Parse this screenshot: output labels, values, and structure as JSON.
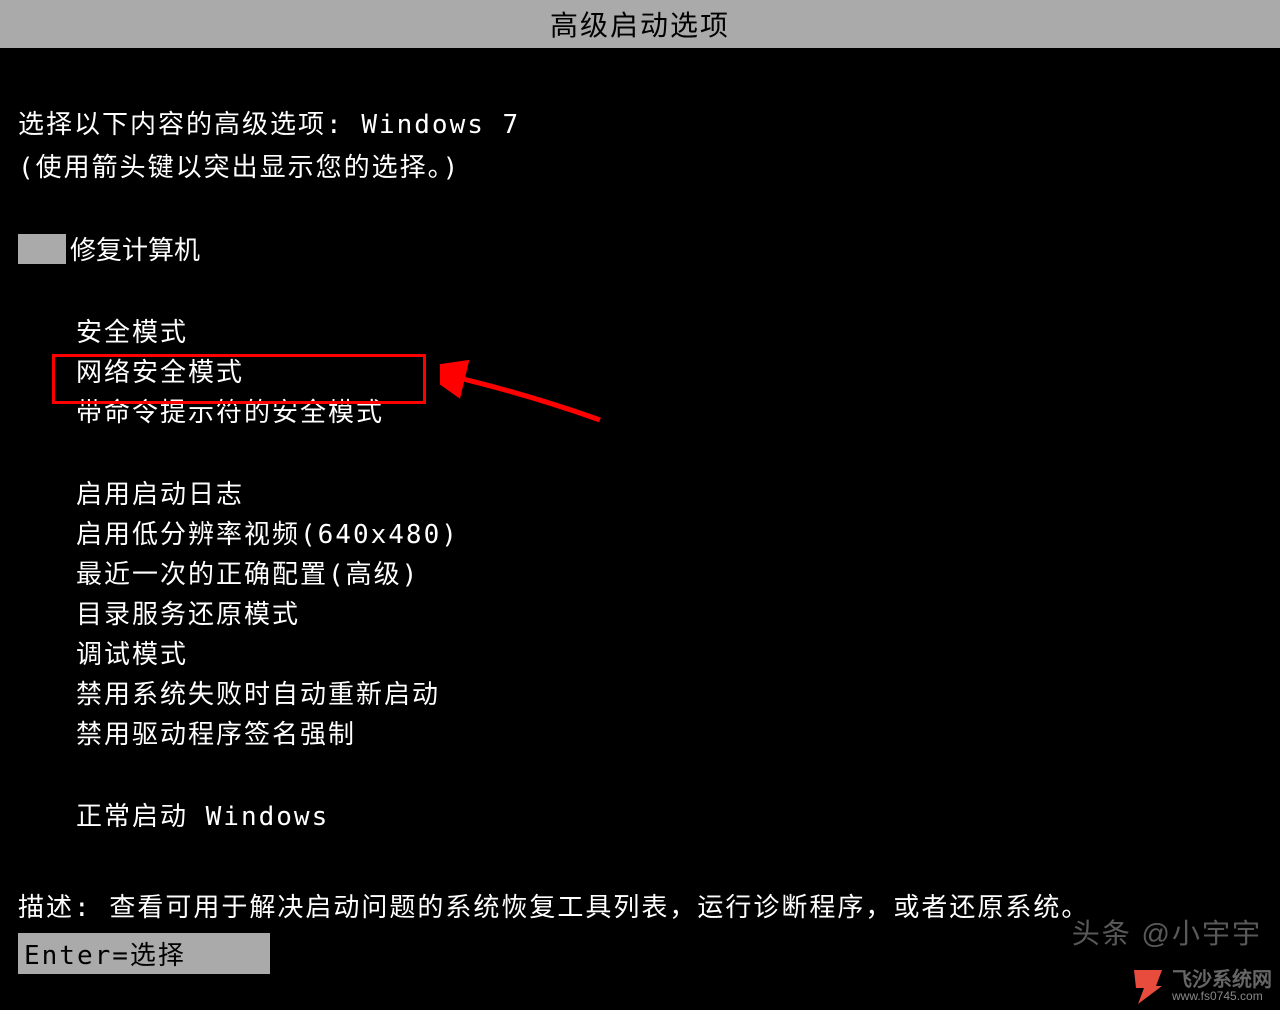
{
  "title": "高级启动选项",
  "prompt_prefix": "选择以下内容的高级选项: ",
  "os_name": "Windows 7",
  "instruction": "(使用箭头键以突出显示您的选择。)",
  "selected_option": "修复计算机",
  "group1": {
    "items": [
      "安全模式",
      "网络安全模式",
      "带命令提示符的安全模式"
    ]
  },
  "group2": {
    "items": [
      "启用启动日志",
      "启用低分辨率视频(640x480)",
      "最近一次的正确配置(高级)",
      "目录服务还原模式",
      "调试模式",
      "禁用系统失败时自动重新启动",
      "禁用驱动程序签名强制"
    ]
  },
  "group3": {
    "items": [
      "正常启动 Windows"
    ]
  },
  "description_label": "描述: ",
  "description_text": "查看可用于解决启动问题的系统恢复工具列表，运行诊断程序，或者还原系统。",
  "footer": "Enter=选择",
  "watermark_top": "头条 @小宇宇",
  "site_name": "飞沙系统网",
  "site_url": "www.fs0745.com",
  "colors": {
    "highlight_border": "#ff0000",
    "arrow": "#ff0000",
    "title_bg": "#aaaaaa"
  }
}
